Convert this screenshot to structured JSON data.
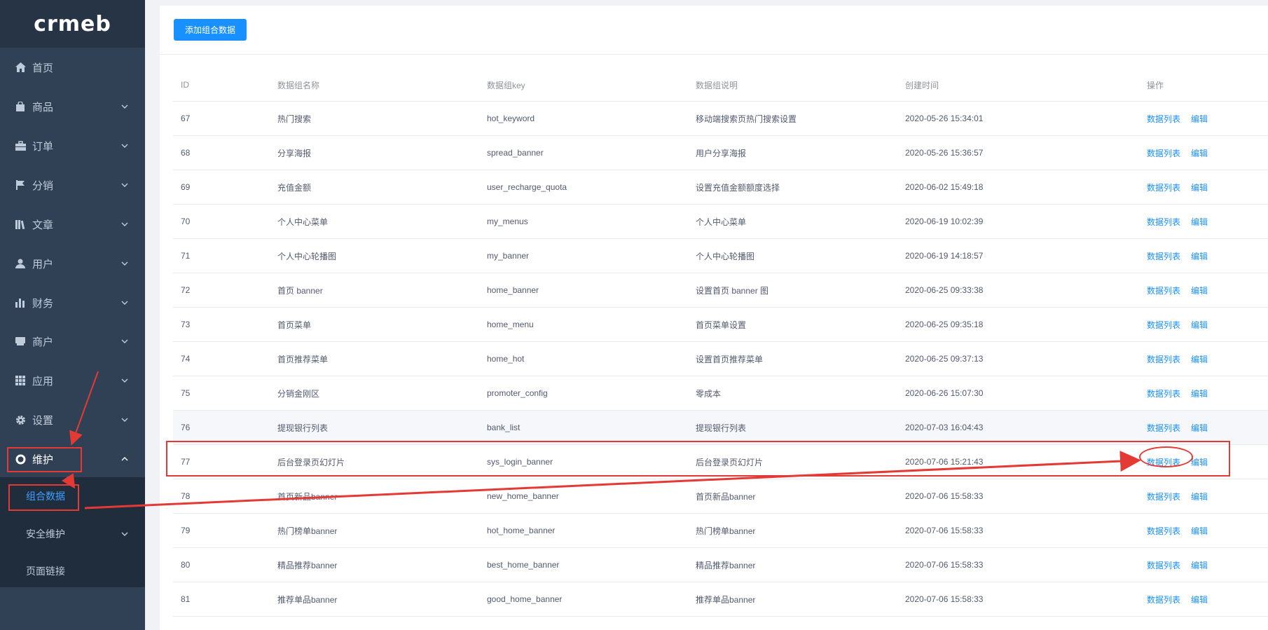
{
  "brand": {
    "logo_text": "crmeb"
  },
  "sidebar": {
    "items": [
      {
        "label": "首页",
        "icon": "home-icon",
        "has_children": false
      },
      {
        "label": "商品",
        "icon": "shopping-bag-icon",
        "has_children": true
      },
      {
        "label": "订单",
        "icon": "briefcase-icon",
        "has_children": true
      },
      {
        "label": "分销",
        "icon": "flag-icon",
        "has_children": true
      },
      {
        "label": "文章",
        "icon": "library-icon",
        "has_children": true
      },
      {
        "label": "用户",
        "icon": "user-icon",
        "has_children": true
      },
      {
        "label": "财务",
        "icon": "bar-chart-icon",
        "has_children": true
      },
      {
        "label": "商户",
        "icon": "printer-icon",
        "has_children": true
      },
      {
        "label": "应用",
        "icon": "grid-icon",
        "has_children": true
      },
      {
        "label": "设置",
        "icon": "gear-icon",
        "has_children": true
      },
      {
        "label": "维护",
        "icon": "lifebuoy-icon",
        "has_children": true,
        "expanded": true
      }
    ],
    "submenu": [
      {
        "label": "组合数据",
        "active": true
      },
      {
        "label": "安全维护",
        "has_children": true
      },
      {
        "label": "页面链接"
      }
    ]
  },
  "toolbar": {
    "add_label": "添加组合数据"
  },
  "table": {
    "columns": [
      "ID",
      "数据组名称",
      "数据组key",
      "数据组说明",
      "创建时间",
      "操作"
    ],
    "rows": [
      {
        "id": "67",
        "name": "热门搜索",
        "key": "hot_keyword",
        "desc": "移动端搜索页热门搜索设置",
        "time": "2020-05-26 15:34:01"
      },
      {
        "id": "68",
        "name": "分享海报",
        "key": "spread_banner",
        "desc": "用户分享海报",
        "time": "2020-05-26 15:36:57"
      },
      {
        "id": "69",
        "name": "充值金额",
        "key": "user_recharge_quota",
        "desc": "设置充值金额额度选择",
        "time": "2020-06-02 15:49:18"
      },
      {
        "id": "70",
        "name": "个人中心菜单",
        "key": "my_menus",
        "desc": "个人中心菜单",
        "time": "2020-06-19 10:02:39"
      },
      {
        "id": "71",
        "name": "个人中心轮播图",
        "key": "my_banner",
        "desc": "个人中心轮播图",
        "time": "2020-06-19 14:18:57"
      },
      {
        "id": "72",
        "name": "首页 banner",
        "key": "home_banner",
        "desc": "设置首页 banner 图",
        "time": "2020-06-25 09:33:38"
      },
      {
        "id": "73",
        "name": "首页菜单",
        "key": "home_menu",
        "desc": "首页菜单设置",
        "time": "2020-06-25 09:35:18"
      },
      {
        "id": "74",
        "name": "首页推荐菜单",
        "key": "home_hot",
        "desc": "设置首页推荐菜单",
        "time": "2020-06-25 09:37:13"
      },
      {
        "id": "75",
        "name": "分销金刚区",
        "key": "promoter_config",
        "desc": "零成本",
        "time": "2020-06-26 15:07:30"
      },
      {
        "id": "76",
        "name": "提现银行列表",
        "key": "bank_list",
        "desc": "提现银行列表",
        "time": "2020-07-03 16:04:43"
      },
      {
        "id": "77",
        "name": "后台登录页幻灯片",
        "key": "sys_login_banner",
        "desc": "后台登录页幻灯片",
        "time": "2020-07-06 15:21:43"
      },
      {
        "id": "78",
        "name": "首页新品banner",
        "key": "new_home_banner",
        "desc": "首页新品banner",
        "time": "2020-07-06 15:58:33"
      },
      {
        "id": "79",
        "name": "热门榜单banner",
        "key": "hot_home_banner",
        "desc": "热门榜单banner",
        "time": "2020-07-06 15:58:33"
      },
      {
        "id": "80",
        "name": "精品推荐banner",
        "key": "best_home_banner",
        "desc": "精品推荐banner",
        "time": "2020-07-06 15:58:33"
      },
      {
        "id": "81",
        "name": "推荐单品banner",
        "key": "good_home_banner",
        "desc": "推荐单品banner",
        "time": "2020-07-06 15:58:33"
      }
    ],
    "action_list": "数据列表",
    "action_edit": "编辑"
  },
  "colors": {
    "sidebar_bg": "#304156",
    "submenu_bg": "#1f2d3d",
    "primary": "#1890ff",
    "annotation": "#e53935"
  }
}
